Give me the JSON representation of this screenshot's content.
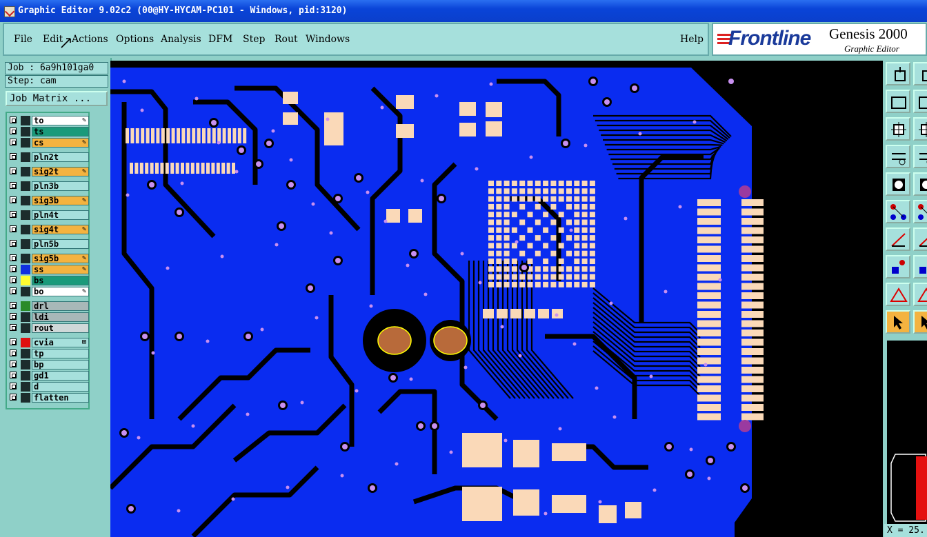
{
  "window": {
    "title": "Graphic Editor 9.02c2 (00@HY-HYCAM-PC101 - Windows, pid:3120)"
  },
  "menu": {
    "items": [
      "File",
      "Edit",
      "Actions",
      "Options",
      "Analysis",
      "DFM",
      "Step",
      "Rout",
      "Windows"
    ],
    "help": "Help"
  },
  "brand": {
    "logo": "Frontline",
    "product": "Genesis 2000",
    "subtitle": "Graphic Editor"
  },
  "job": {
    "job_label": "Job : 6a9h101ga0",
    "step_label": "Step: cam",
    "matrix_button": "Job Matrix ..."
  },
  "layers": [
    {
      "name": "to",
      "bg": "#ffffff",
      "swatch": "#1c2c2c",
      "icon": "pen-icon"
    },
    {
      "name": "ts",
      "bg": "#1a9a7a",
      "swatch": "#1c2c2c",
      "icon": ""
    },
    {
      "name": "cs",
      "bg": "#f4b340",
      "swatch": "#1c2c2c",
      "icon": "pen-icon"
    },
    {
      "name": "pln2t",
      "bg": "#a6e0dc",
      "swatch": "#1c2c2c",
      "icon": ""
    },
    {
      "name": "sig2t",
      "bg": "#f4b340",
      "swatch": "#1c2c2c",
      "icon": "pen-icon"
    },
    {
      "name": "pln3b",
      "bg": "#a6e0dc",
      "swatch": "#1c2c2c",
      "icon": ""
    },
    {
      "name": "sig3b",
      "bg": "#f4b340",
      "swatch": "#1c2c2c",
      "icon": "pen-icon"
    },
    {
      "name": "pln4t",
      "bg": "#a6e0dc",
      "swatch": "#1c2c2c",
      "icon": ""
    },
    {
      "name": "sig4t",
      "bg": "#f4b340",
      "swatch": "#1c2c2c",
      "icon": "pen-icon"
    },
    {
      "name": "pln5b",
      "bg": "#a6e0dc",
      "swatch": "#1c2c2c",
      "icon": ""
    },
    {
      "name": "sig5b",
      "bg": "#f4b340",
      "swatch": "#1c2c2c",
      "icon": "pen-icon"
    },
    {
      "name": "ss",
      "bg": "#f4b340",
      "swatch": "#1030e0",
      "icon": "pen-icon"
    },
    {
      "name": "bs",
      "bg": "#1a9a7a",
      "swatch": "#ffff30",
      "icon": ""
    },
    {
      "name": "bo",
      "bg": "#ffffff",
      "swatch": "#1c2c2c",
      "icon": "pen-icon"
    },
    {
      "name": "drl",
      "bg": "#a8b8b8",
      "swatch": "#2a8a2a",
      "icon": ""
    },
    {
      "name": "ldi",
      "bg": "#a8b8b8",
      "swatch": "#1c2c2c",
      "icon": ""
    },
    {
      "name": "rout",
      "bg": "#cfd8d8",
      "swatch": "#1c2c2c",
      "icon": ""
    },
    {
      "name": "cvia",
      "bg": "#a6e0dc",
      "swatch": "#e01010",
      "icon": "expand-icon"
    },
    {
      "name": "tp",
      "bg": "#a6e0dc",
      "swatch": "#1c2c2c",
      "icon": ""
    },
    {
      "name": "bp",
      "bg": "#a6e0dc",
      "swatch": "#1c2c2c",
      "icon": ""
    },
    {
      "name": "gd1",
      "bg": "#a6e0dc",
      "swatch": "#1c2c2c",
      "icon": ""
    },
    {
      "name": "d",
      "bg": "#a6e0dc",
      "swatch": "#1c2c2c",
      "icon": ""
    },
    {
      "name": "flatten",
      "bg": "#a6e0dc",
      "swatch": "#1c2c2c",
      "icon": ""
    }
  ],
  "toolbar": {
    "tools": [
      "move-icon",
      "window-icon",
      "snap-icon",
      "resize-icon",
      "zoom-fit-icon",
      "pan-icon",
      "measure-icon",
      "grid-icon",
      "select-icon",
      "feature-icon",
      "net-icon",
      "cross-icon",
      "line-icon",
      "slash-icon",
      "pad-icon",
      "minus-icon",
      "triangle-icon",
      "triangle2-icon",
      "pointer-icon",
      "pointer2-icon"
    ]
  },
  "colors": {
    "board": "#0a2cf0",
    "trace": "#000000",
    "pad": "#fad9b8",
    "via": "#c890f0",
    "copper": "#b86a3a"
  },
  "status": {
    "coordinate": "X = 25."
  }
}
